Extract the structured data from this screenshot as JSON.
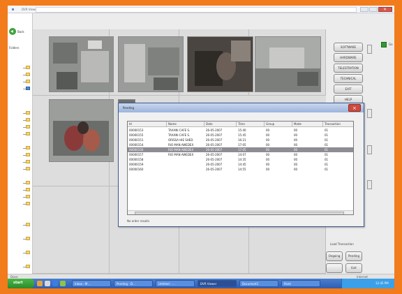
{
  "window": {
    "title": "DVR Viewer",
    "colors": {
      "frame": "#f27b1c",
      "taskbar": "#2f5db0",
      "close": "#d14a3b"
    }
  },
  "left_panel": {
    "back_label": "Back",
    "folders_label": "Folders"
  },
  "side_buttons": [
    {
      "label": "SOFTWARE"
    },
    {
      "label": "HARDWARE"
    },
    {
      "label": "TELESTRATION"
    },
    {
      "label": "TECHNICAL"
    },
    {
      "label": "EXIT"
    },
    {
      "label": "HELP"
    }
  ],
  "right_panel_label": "Go",
  "cameras": [
    {
      "name": "camera-1",
      "icon": "cctv-feed"
    },
    {
      "name": "camera-2",
      "icon": "cctv-feed"
    },
    {
      "name": "camera-3",
      "icon": "cctv-feed"
    },
    {
      "name": "camera-4",
      "icon": "cctv-feed"
    },
    {
      "name": "camera-5",
      "icon": "cctv-feed"
    }
  ],
  "dialog": {
    "title": "Pending",
    "columns": [
      "Id",
      "Name",
      "Date",
      "Time",
      "Group",
      "Mode",
      "Transaction"
    ],
    "rows": [
      [
        "00000153",
        "TAXANI CAFE S.",
        "26-05-2007",
        "15:40",
        "00",
        "00",
        "01"
      ],
      [
        "00000155",
        "TAXANI CAFE S.",
        "26-05-2007",
        "15:45",
        "00",
        "00",
        "01"
      ],
      [
        "00000151",
        "ORISSA HIE SHED",
        "26-05-2007",
        "16:21",
        "00",
        "00",
        "01"
      ],
      [
        "00000154",
        "RIO MAN AWEDEX",
        "26-05-2007",
        "17:05",
        "00",
        "00",
        "01"
      ],
      [
        "00000156",
        "RIO MAN AWEDEX",
        "26-05-2007",
        "17:05",
        "00",
        "00",
        "01"
      ],
      [
        "00000157",
        "RIO MAN AWEDEX",
        "26-05-2007",
        "14:07",
        "00",
        "00",
        "01"
      ],
      [
        "00000158",
        "",
        "26-05-2007",
        "14:35",
        "00",
        "00",
        "01"
      ],
      [
        "00000159",
        "",
        "26-05-2007",
        "14:45",
        "00",
        "00",
        "01"
      ],
      [
        "00000160",
        "",
        "26-05-2007",
        "14:55",
        "00",
        "00",
        "01"
      ]
    ],
    "selected_row": 4,
    "status_text": "No order results"
  },
  "load_transaction": {
    "label": "Load Transaction",
    "buttons": [
      "Ongoing",
      "Pending",
      "",
      "Exit"
    ]
  },
  "statusbar": {
    "left": "Done",
    "right": "Internet"
  },
  "taskbar": {
    "start_label": "start",
    "tasks": [
      "Inbox - M...",
      "Pending - D...",
      "Untitled - ...",
      "DVR Viewer",
      "Document1",
      "Paint"
    ],
    "clock": "12:45 PM"
  }
}
